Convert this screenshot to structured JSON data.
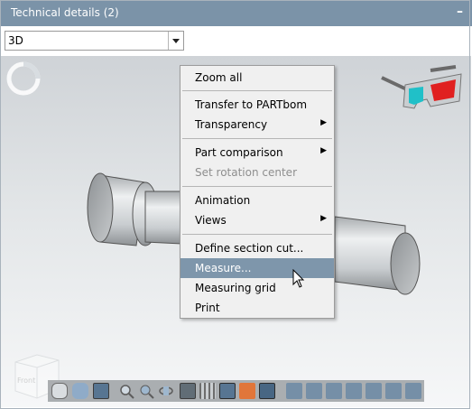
{
  "window": {
    "title": "Technical details (2)",
    "minimize_glyph": "–"
  },
  "view_select": {
    "value": "3D",
    "arrow_icon": "chevron-down-icon"
  },
  "icons": {
    "rotation": "rotation-indicator-icon",
    "glasses": "3d-glasses-icon",
    "cube": "navigation-cube-icon",
    "cursor": "mouse-pointer-icon"
  },
  "nav_cube_label": "Front",
  "context_menu": {
    "items": [
      {
        "label": "Zoom all"
      },
      {
        "label": "Transfer to PARTbom"
      },
      {
        "label": "Transparency",
        "submenu": "▶"
      },
      {
        "label": "Part comparison",
        "submenu": "▶"
      },
      {
        "label": "Set rotation center",
        "disabled": true
      },
      {
        "label": "Animation"
      },
      {
        "label": "Views",
        "submenu": "▶"
      },
      {
        "label": "Define section cut..."
      },
      {
        "label": "Measure...",
        "highlighted": true
      },
      {
        "label": "Measuring grid"
      },
      {
        "label": "Print"
      }
    ]
  },
  "colors": {
    "title_bar": "#7b93a8",
    "menu_highlight": "#7e96ab",
    "glasses_left": "#20c0c8",
    "glasses_right": "#e02020"
  }
}
